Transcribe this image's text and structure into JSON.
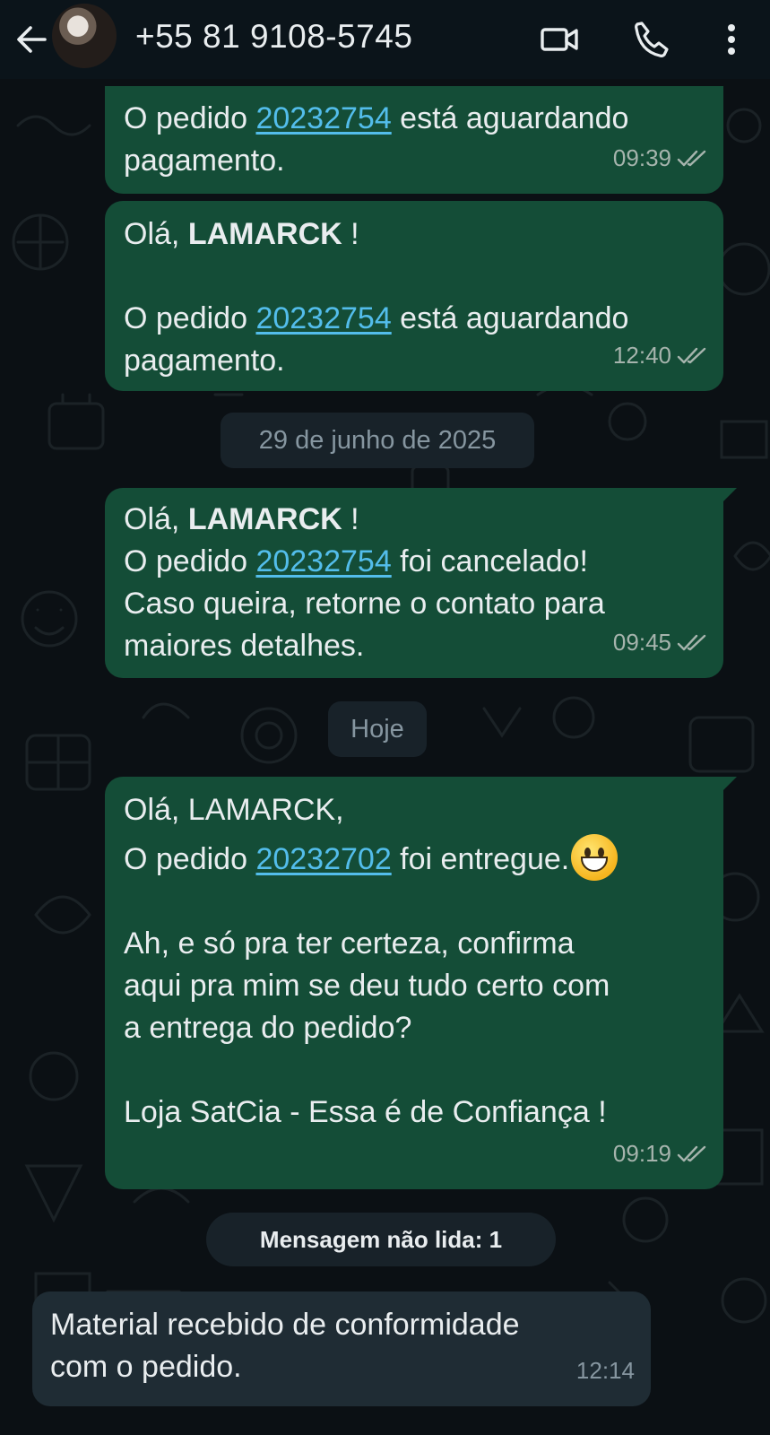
{
  "header": {
    "contact_name": "+55 81 9108-5745",
    "icons": [
      "back-arrow-icon",
      "video-call-icon",
      "phone-icon",
      "more-vertical-icon"
    ]
  },
  "colors": {
    "outgoing_bubble": "#144d37",
    "incoming_bubble": "#1f2c34",
    "link": "#53bdeb",
    "background": "#0b1014"
  },
  "messages": [
    {
      "line1_pre": "O pedido ",
      "line1_link": "20232754",
      "line1_post": " está aguardando",
      "line2": "pagamento.",
      "time": "09:39"
    },
    {
      "greet_pre": "Olá, ",
      "greet_name": "LAMARCK",
      "greet_post": " !",
      "line1_pre": "O pedido ",
      "line1_link": "20232754",
      "line1_post": " está aguardando",
      "line2": "pagamento.",
      "time": "12:40"
    },
    {
      "greet_pre": "Olá, ",
      "greet_name": "LAMARCK",
      "greet_post": " !",
      "line1_pre": "O pedido ",
      "line1_link": "20232754",
      "line1_post": " foi cancelado!",
      "line2": "Caso queira, retorne o contato para",
      "line3": "maiores detalhes.",
      "time": "09:45"
    },
    {
      "greet": "Olá, LAMARCK,",
      "line1_pre": "O pedido ",
      "line1_link": "20232702",
      "line1_post": " foi entregue.",
      "emoji": "grinning-face-emoji",
      "line2": "Ah, e só pra ter certeza, confirma",
      "line3": "aqui pra mim se deu tudo certo com",
      "line4": "a entrega do pedido?",
      "line5": "Loja SatCia - Essa é de Confiança !",
      "time": "09:19"
    },
    {
      "line1": "Material recebido de conformidade",
      "line2": "com o pedido.",
      "time": "12:14"
    }
  ],
  "date_separators": {
    "first": "29 de junho de 2025",
    "second": "Hoje"
  },
  "unread_banner": "Mensagem não lida: 1"
}
